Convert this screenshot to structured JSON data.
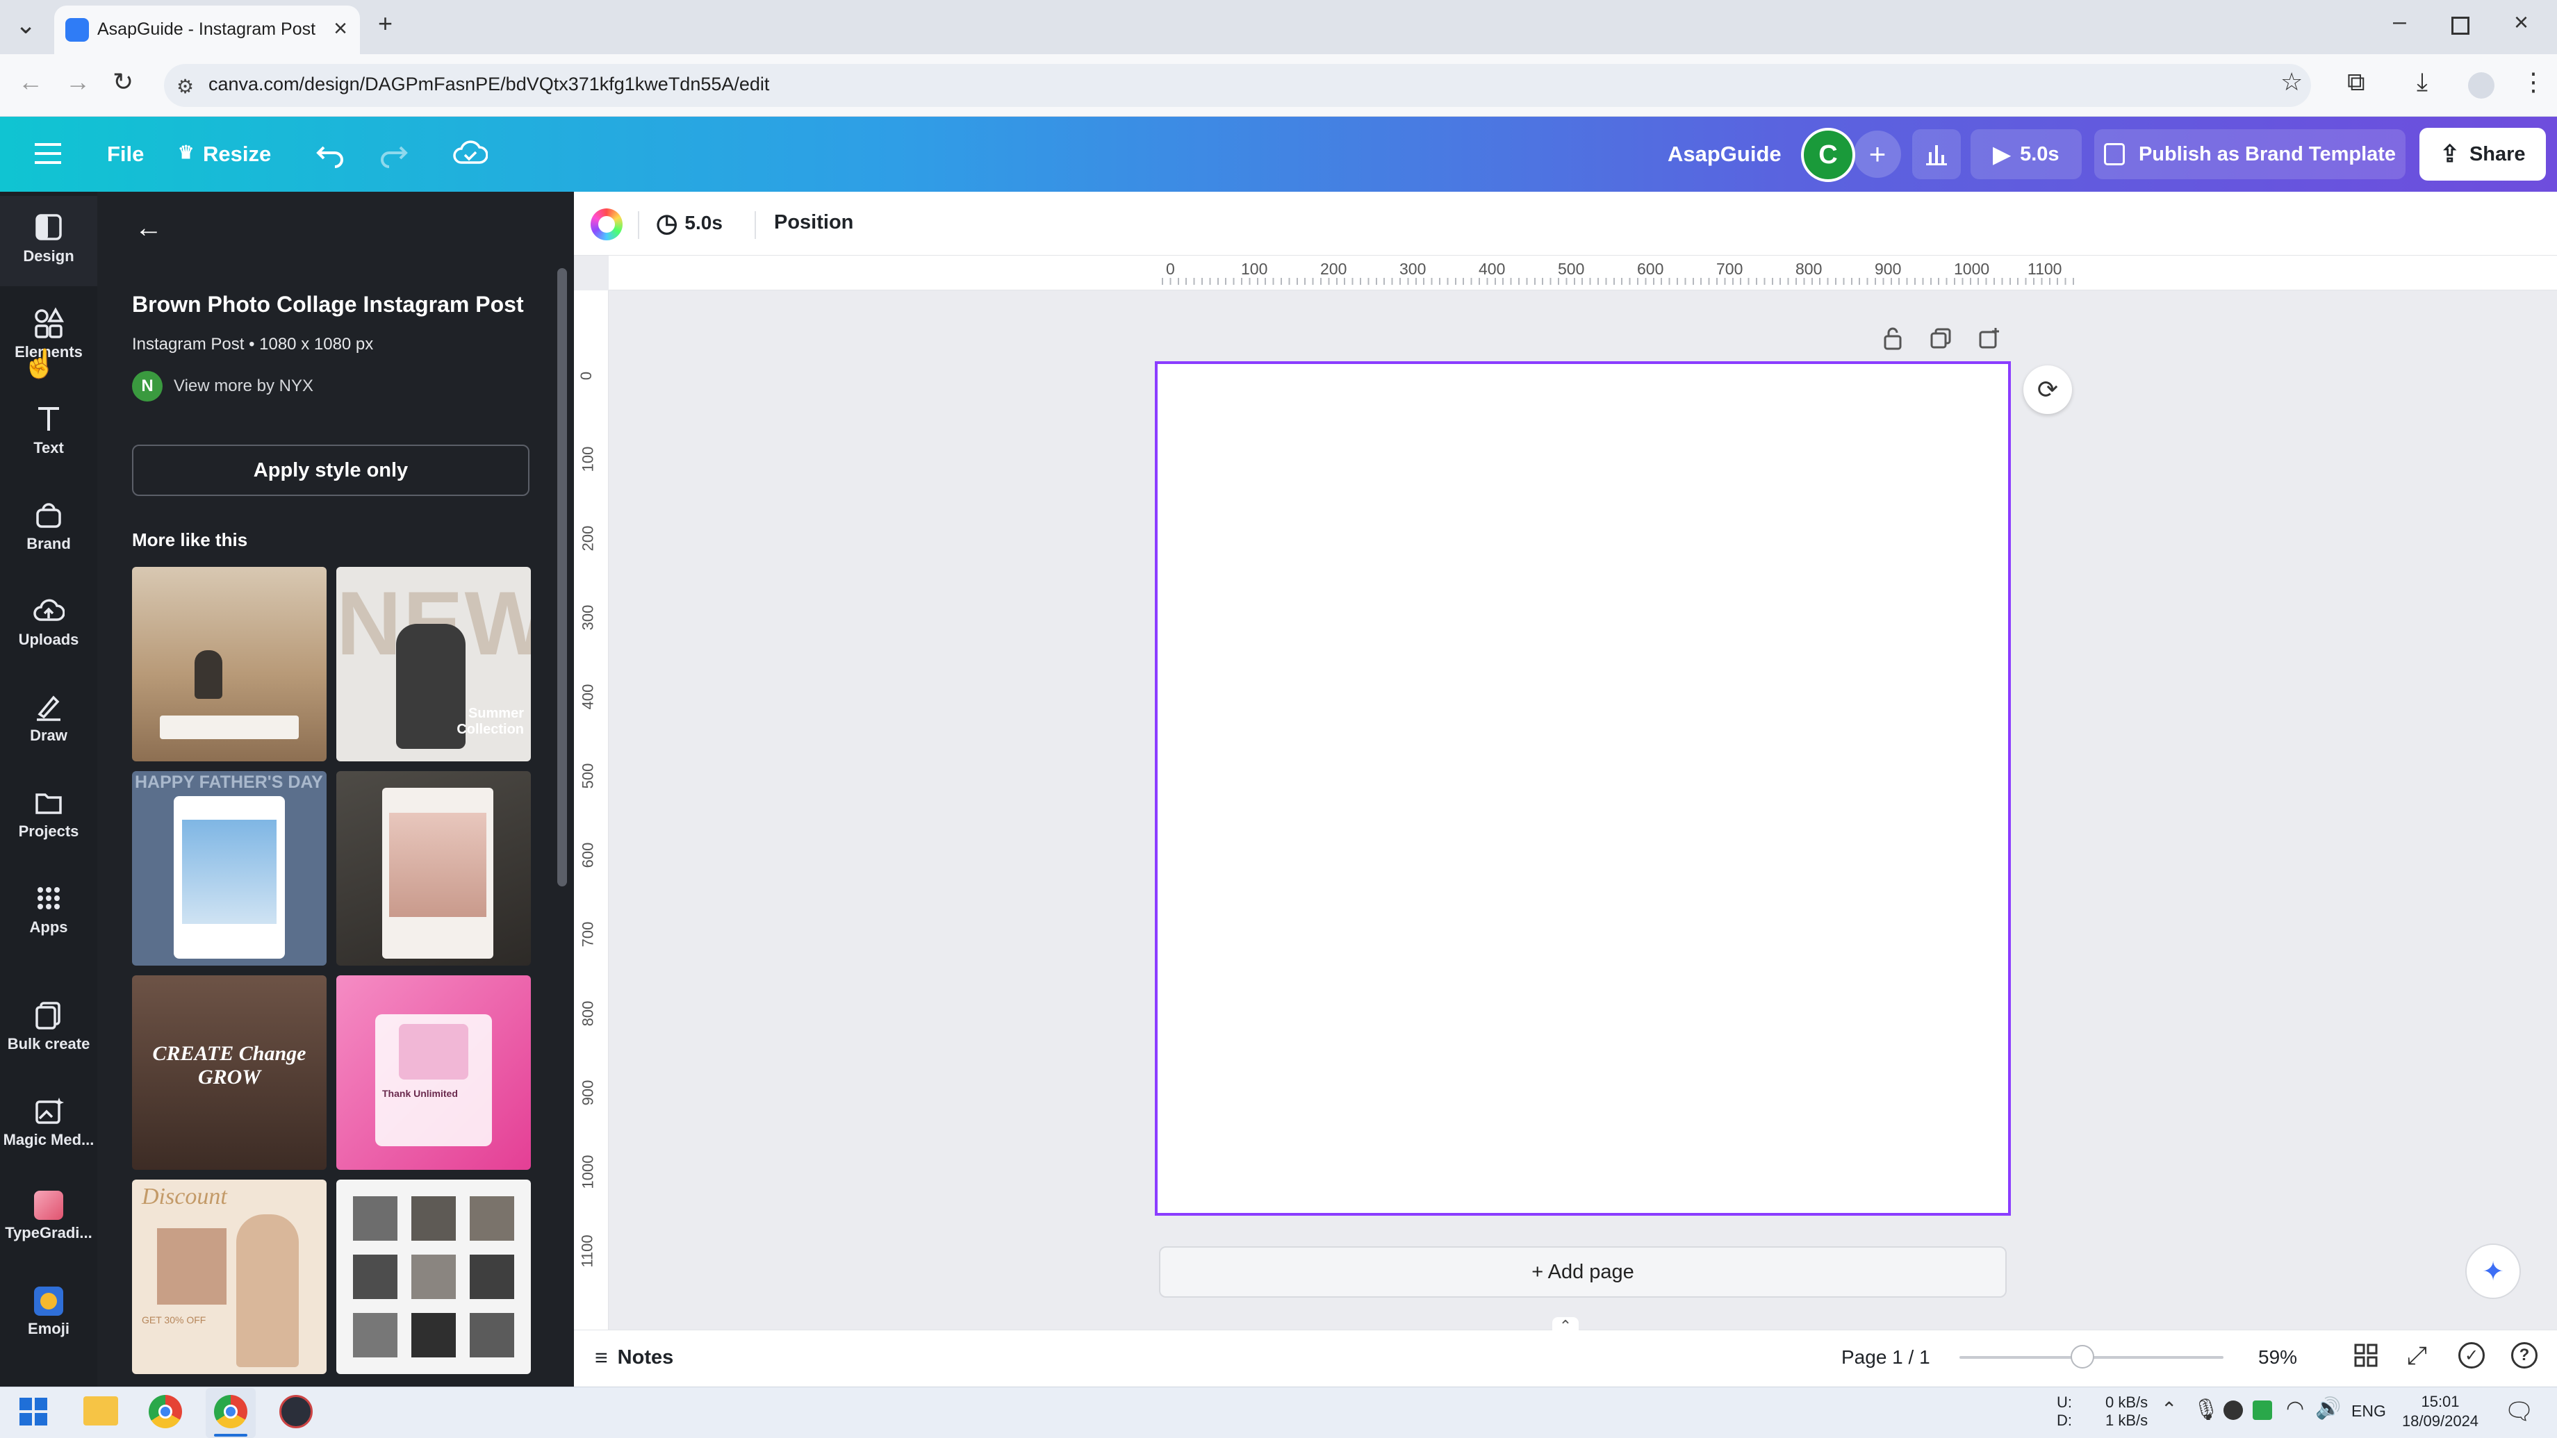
{
  "browser": {
    "tab_title": "AsapGuide - Instagram Post",
    "url": "canva.com/design/DAGPmFasnPE/bdVQtx371kfg1kweTdn55A/edit"
  },
  "header": {
    "file_label": "File",
    "resize_label": "Resize",
    "team_name": "AsapGuide",
    "avatar_letter": "C",
    "play_duration": "5.0s",
    "publish_label": "Publish as Brand Template",
    "share_label": "Share"
  },
  "rail": {
    "items": [
      {
        "label": "Design",
        "icon": "design-icon"
      },
      {
        "label": "Elements",
        "icon": "elements-icon"
      },
      {
        "label": "Text",
        "icon": "text-icon"
      },
      {
        "label": "Brand",
        "icon": "brand-icon"
      },
      {
        "label": "Uploads",
        "icon": "uploads-icon"
      },
      {
        "label": "Draw",
        "icon": "draw-icon"
      },
      {
        "label": "Projects",
        "icon": "projects-icon"
      },
      {
        "label": "Apps",
        "icon": "apps-icon"
      },
      {
        "label": "Bulk create",
        "icon": "bulk-create-icon"
      },
      {
        "label": "Magic Med...",
        "icon": "magic-media-icon"
      },
      {
        "label": "TypeGradi...",
        "icon": "typegradient-icon"
      },
      {
        "label": "Emoji",
        "icon": "emoji-icon"
      }
    ]
  },
  "panel": {
    "template_title": "Brown Photo Collage Instagram Post",
    "template_meta": "Instagram Post • 1080 x 1080 px",
    "creator_initial": "N",
    "creator_link": "View more by NYX",
    "apply_style_label": "Apply style only",
    "more_like_this": "More like this",
    "thumb_texts": {
      "t2_big": "NEW",
      "t2_small": "Summer Collection",
      "t3_text": "HAPPY FATHER'S DAY",
      "t5_text": "CREATE Change GROW",
      "t6_text": "Thank Unlimited",
      "t7_text": "Discount",
      "t7_sub": "GET 30% OFF"
    }
  },
  "toolbar": {
    "duration": "5.0s",
    "position_label": "Position"
  },
  "rulers": {
    "top_ticks": [
      "0",
      "100",
      "200",
      "300",
      "400",
      "500",
      "600",
      "700",
      "800",
      "900",
      "1000",
      "1100"
    ],
    "left_ticks": [
      "0",
      "100",
      "200",
      "300",
      "400",
      "500",
      "600",
      "700",
      "800",
      "900",
      "1000",
      "1100"
    ]
  },
  "canvas": {
    "add_page_label": "+ Add page"
  },
  "footer": {
    "notes_label": "Notes",
    "page_indicator": "Page 1 / 1",
    "zoom_level": "59%"
  },
  "taskbar": {
    "net_up": "0 kB/s",
    "net_down": "1 kB/s",
    "net_u": "U:",
    "net_d": "D:",
    "lang": "ENG",
    "time": "15:01",
    "date": "18/09/2024"
  },
  "colors": {
    "accent": "#8b3dff",
    "header_start": "#10c4d2",
    "header_end": "#6e4ddd",
    "avatar_green": "#1a9a3a"
  }
}
